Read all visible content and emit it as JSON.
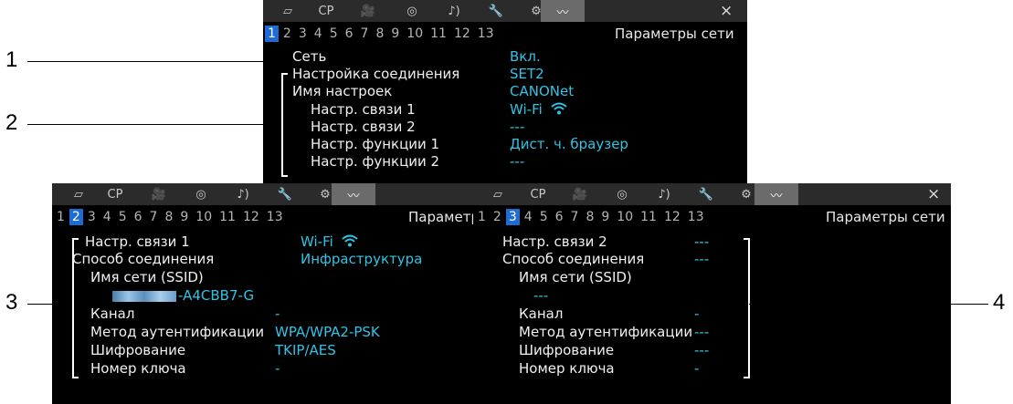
{
  "tabs": [
    "▱",
    "CP",
    "🎥",
    "◎",
    "♪)",
    "🔧",
    "⚙",
    "〰"
  ],
  "close_label": "×",
  "pages": [
    "1",
    "2",
    "3",
    "4",
    "5",
    "6",
    "7",
    "8",
    "9",
    "10",
    "11",
    "12",
    "13"
  ],
  "callouts": [
    "1",
    "2",
    "3",
    "4"
  ],
  "panel1": {
    "title": "Параметры сети",
    "rows": [
      {
        "label": "Сеть",
        "value": "Вкл."
      },
      {
        "label": "Настройка соединения",
        "value": "SET2"
      },
      {
        "label": "Имя настроек",
        "value": "CANONet"
      },
      {
        "label": "Настр. связи 1",
        "value": "Wi-Fi"
      },
      {
        "label": "Настр. связи 2",
        "value": "---"
      },
      {
        "label": "Настр. функции 1",
        "value": "Дист. ч. браузер"
      },
      {
        "label": "Настр. функции 2",
        "value": "---"
      }
    ]
  },
  "panel2": {
    "title": "Параметр",
    "rows": [
      {
        "label": "Настр. связи 1",
        "value": "Wi-Fi"
      },
      {
        "label": "Способ соединения",
        "value": "Инфраструктура"
      },
      {
        "label": "Имя сети (SSID)",
        "value": ""
      },
      {
        "label": "",
        "value": "-A4CBB7-G"
      },
      {
        "label": "Канал",
        "value": "-"
      },
      {
        "label": "Метод аутентификации",
        "value": "WPA/WPA2-PSK"
      },
      {
        "label": "Шифрование",
        "value": "TKIP/AES"
      },
      {
        "label": "Номер ключа",
        "value": "-"
      }
    ]
  },
  "panel3": {
    "title": "Параметры сети",
    "rows": [
      {
        "label": "Настр. связи 2",
        "value": "---"
      },
      {
        "label": "Способ соединения",
        "value": "---"
      },
      {
        "label": "Имя сети (SSID)",
        "value": ""
      },
      {
        "label": "",
        "value": "---"
      },
      {
        "label": "Канал",
        "value": "-"
      },
      {
        "label": "Метод аутентификации",
        "value": "---"
      },
      {
        "label": "Шифрование",
        "value": "---"
      },
      {
        "label": "Номер ключа",
        "value": "-"
      }
    ]
  },
  "colors": {
    "value": "#2fc4e6",
    "active_page": "#1e6bd3",
    "active_tab": "#6b6b6b"
  }
}
